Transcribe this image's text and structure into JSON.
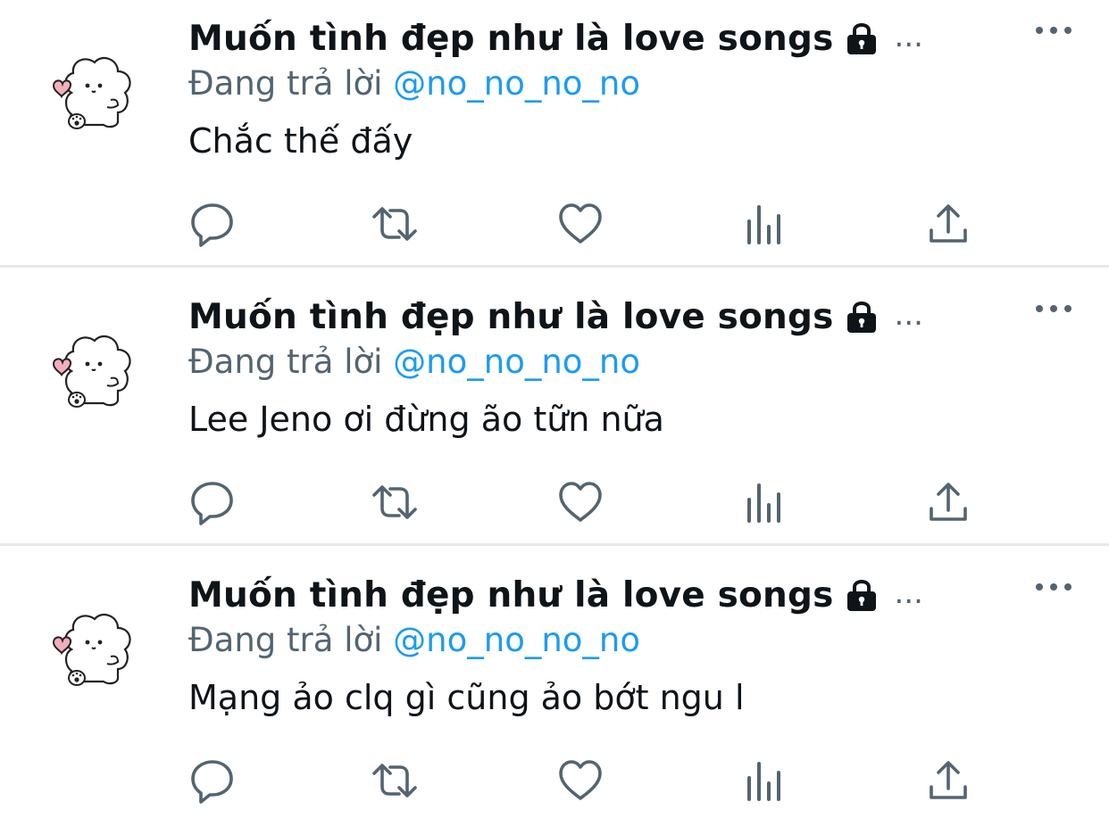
{
  "colors": {
    "mention": "#1d9bf0",
    "secondary": "#536471",
    "primary": "#0f1419"
  },
  "tweets": [
    {
      "name": "Muốn tình đẹp như là love songs",
      "ellipsis": "...",
      "reply_prefix": "Đang trả lời",
      "reply_handle": "@no_no_no_no",
      "text": "Chắc thế đấy",
      "icons": [
        "reply-icon",
        "retweet-icon",
        "like-icon",
        "analytics-icon",
        "share-icon"
      ]
    },
    {
      "name": "Muốn tình đẹp như là love songs",
      "ellipsis": "...",
      "reply_prefix": "Đang trả lời",
      "reply_handle": "@no_no_no_no",
      "text": "Lee Jeno ơi đừng ão tữn nữa",
      "icons": [
        "reply-icon",
        "retweet-icon",
        "like-icon",
        "analytics-icon",
        "share-icon"
      ]
    },
    {
      "name": "Muốn tình đẹp như là love songs",
      "ellipsis": "...",
      "reply_prefix": "Đang trả lời",
      "reply_handle": "@no_no_no_no",
      "text": "Mạng ảo clq gì cũng ảo bớt ngu l",
      "icons": [
        "reply-icon",
        "retweet-icon",
        "like-icon",
        "analytics-icon",
        "share-icon"
      ]
    }
  ]
}
